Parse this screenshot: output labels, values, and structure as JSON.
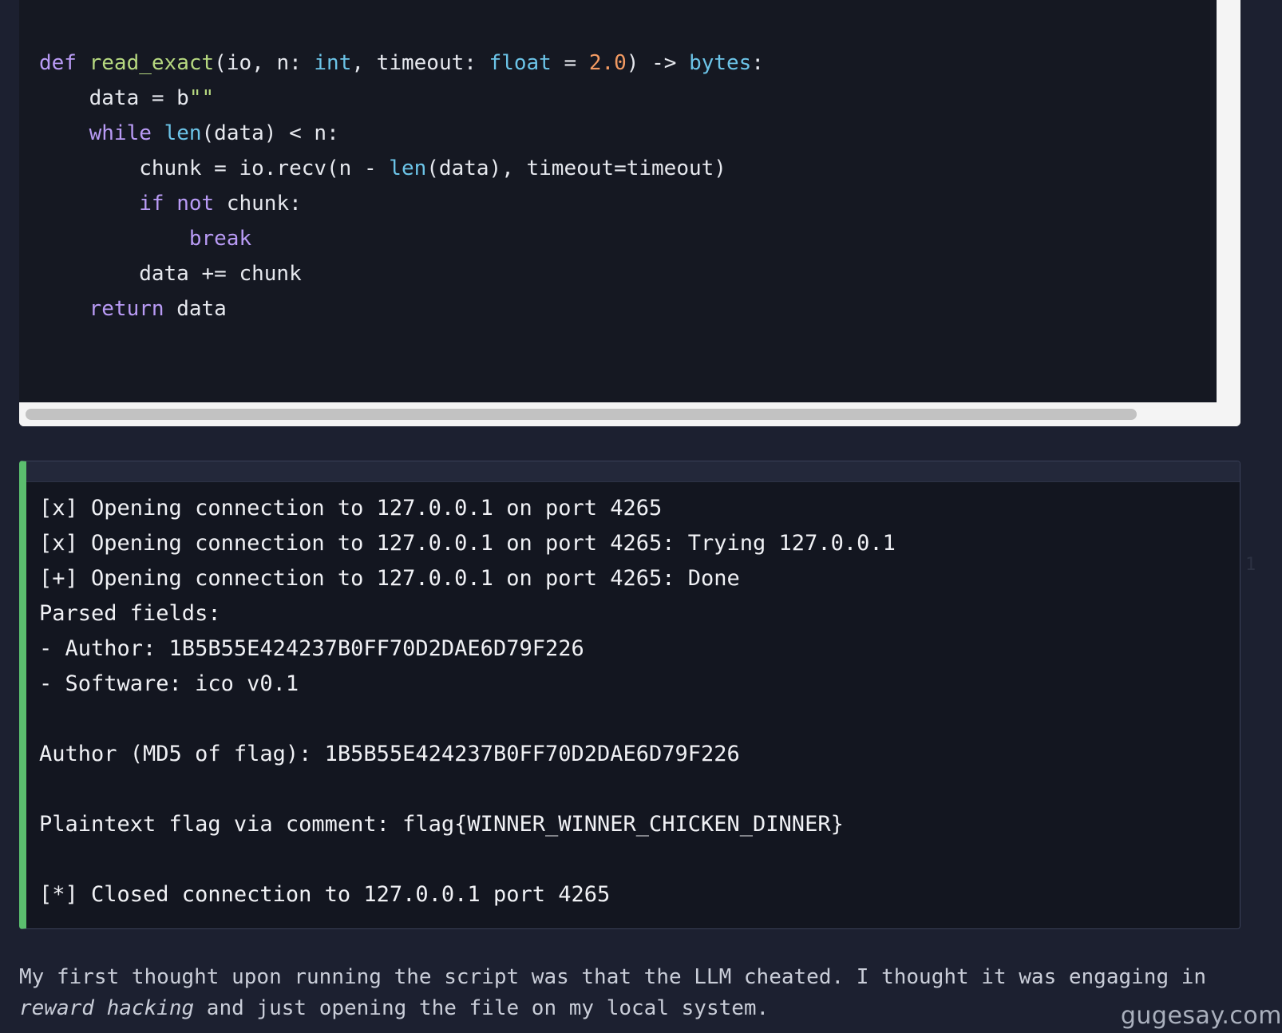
{
  "code": {
    "lines": [
      [
        {
          "t": "def ",
          "c": "kw"
        },
        {
          "t": "read_exact",
          "c": "fn"
        },
        {
          "t": "(io, n: ",
          "c": ""
        },
        {
          "t": "int",
          "c": "bi"
        },
        {
          "t": ", timeout: ",
          "c": ""
        },
        {
          "t": "float",
          "c": "bi"
        },
        {
          "t": " = ",
          "c": ""
        },
        {
          "t": "2.0",
          "c": "num"
        },
        {
          "t": ") -> ",
          "c": ""
        },
        {
          "t": "bytes",
          "c": "bi"
        },
        {
          "t": ":",
          "c": ""
        }
      ],
      [
        {
          "t": "    data = b",
          "c": ""
        },
        {
          "t": "\"\"",
          "c": "str"
        }
      ],
      [
        {
          "t": "    ",
          "c": ""
        },
        {
          "t": "while",
          "c": "kw"
        },
        {
          "t": " ",
          "c": ""
        },
        {
          "t": "len",
          "c": "bi"
        },
        {
          "t": "(data) < n:",
          "c": ""
        }
      ],
      [
        {
          "t": "        chunk = io.recv(n - ",
          "c": ""
        },
        {
          "t": "len",
          "c": "bi"
        },
        {
          "t": "(data), timeout=timeout)",
          "c": ""
        }
      ],
      [
        {
          "t": "        ",
          "c": ""
        },
        {
          "t": "if",
          "c": "kw"
        },
        {
          "t": " ",
          "c": ""
        },
        {
          "t": "not",
          "c": "kw"
        },
        {
          "t": " chunk:",
          "c": ""
        }
      ],
      [
        {
          "t": "            ",
          "c": ""
        },
        {
          "t": "break",
          "c": "kw"
        }
      ],
      [
        {
          "t": "        data += chunk",
          "c": ""
        }
      ],
      [
        {
          "t": "    ",
          "c": ""
        },
        {
          "t": "return",
          "c": "kw"
        },
        {
          "t": " data",
          "c": ""
        }
      ]
    ]
  },
  "output": {
    "lines": [
      "[x] Opening connection to 127.0.0.1 on port 4265",
      "[x] Opening connection to 127.0.0.1 on port 4265: Trying 127.0.0.1",
      "[+] Opening connection to 127.0.0.1 on port 4265: Done",
      "Parsed fields:",
      "- Author: 1B5B55E424237B0FF70D2DAE6D79F226",
      "- Software: ico v0.1",
      "",
      "Author (MD5 of flag): 1B5B55E424237B0FF70D2DAE6D79F226",
      "",
      "Plaintext flag via comment: flag{WINNER_WINNER_CHICKEN_DINNER}",
      "",
      "[*] Closed connection to 127.0.0.1 port 4265"
    ]
  },
  "prose": {
    "part1": "My first thought upon running the script was that the LLM cheated. I thought it was engaging in ",
    "emphasis": "reward hacking",
    "part2": " and just opening the file on my local system."
  },
  "side_marker": "1",
  "watermark": "gugesay.com",
  "colors": {
    "page_bg": "#1c2030",
    "code_bg": "#151822",
    "output_accent": "#5bbe6e",
    "keyword": "#b99bf5",
    "function": "#b6d880",
    "builtin": "#6cc4e8",
    "number": "#f29a62"
  }
}
